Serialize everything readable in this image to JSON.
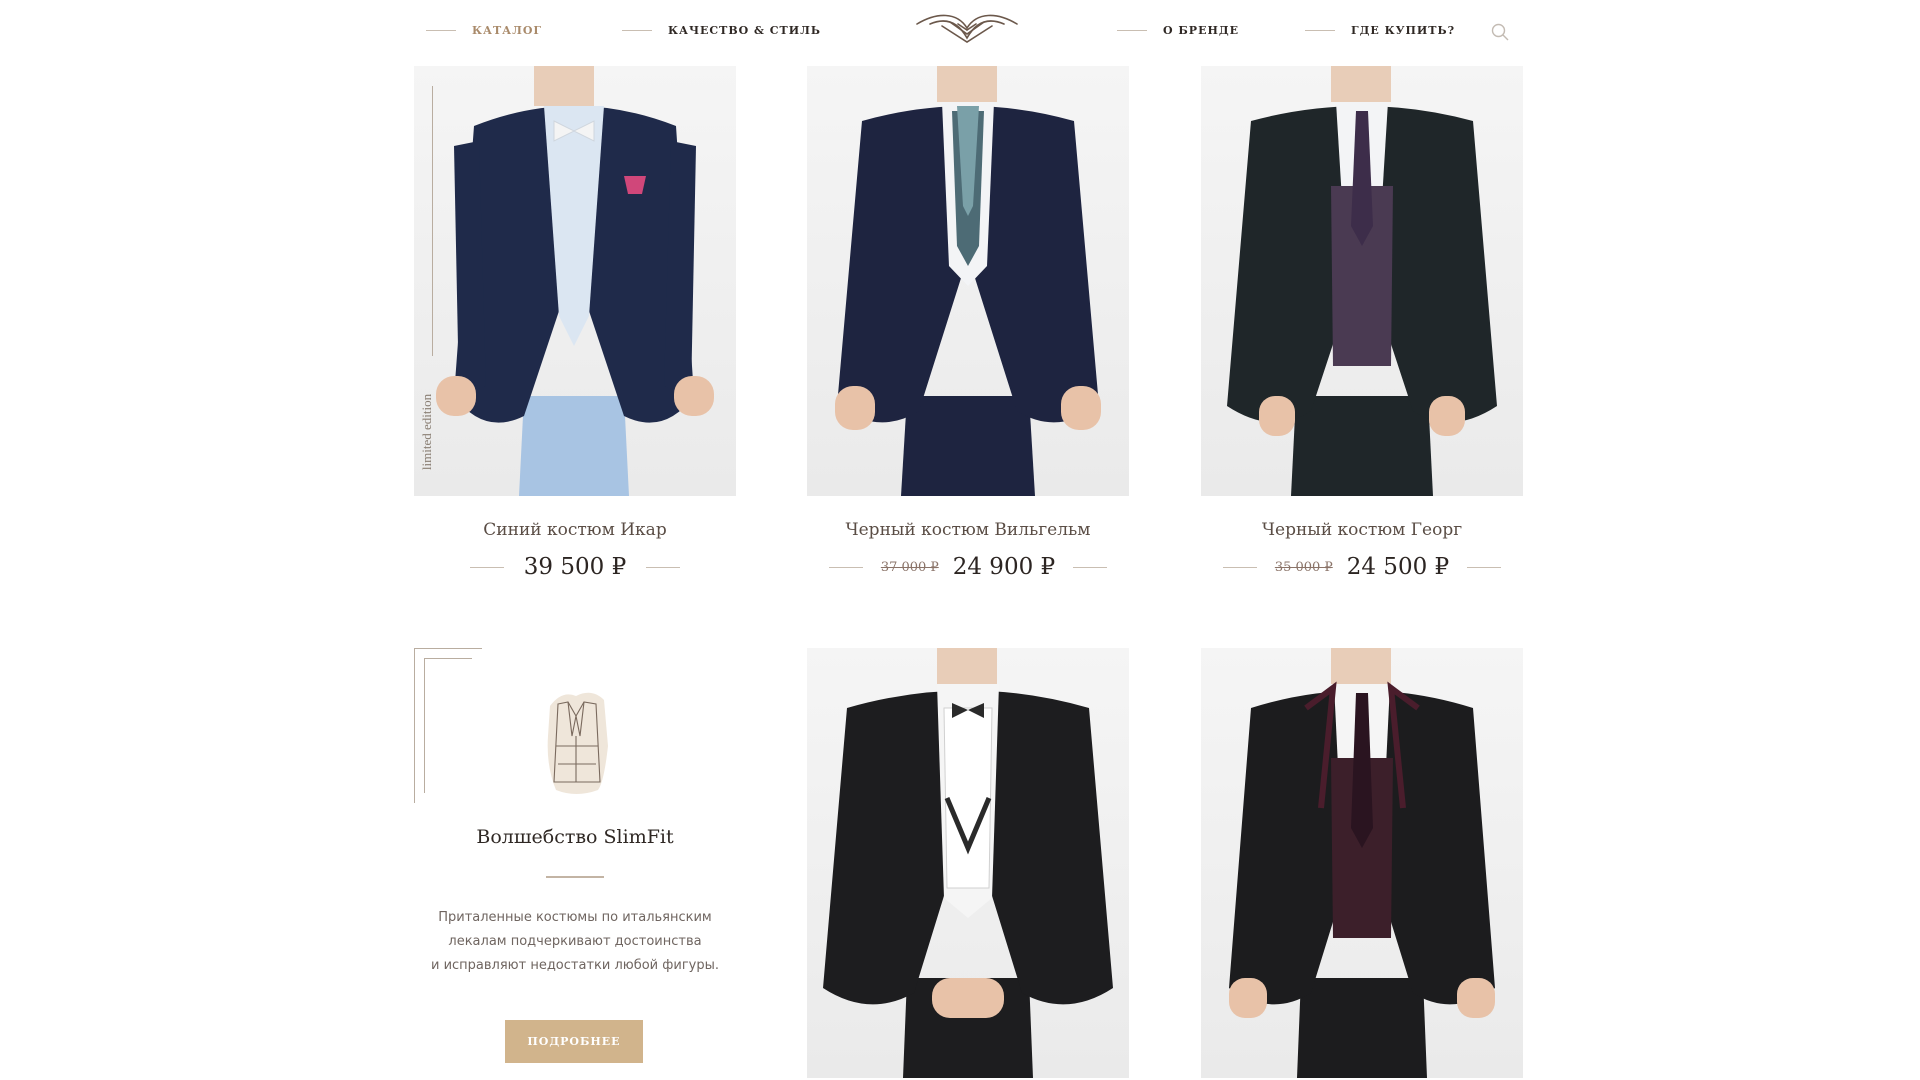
{
  "nav": {
    "items": [
      {
        "label": "КАТАЛОГ",
        "active": true
      },
      {
        "label": "КАЧЕСТВО & СТИЛЬ",
        "active": false
      },
      {
        "label": "О БРЕНДЕ",
        "active": false
      },
      {
        "label": "ГДЕ КУПИТЬ?",
        "active": false
      }
    ],
    "logo_icon": "ornament-logo-icon",
    "search_icon": "search-icon"
  },
  "products": [
    {
      "title": "Синий костюм Икар",
      "price": "39 500 ₽",
      "old_price": "",
      "badge": "limited edition",
      "jacket_color": "#1f2a4a",
      "shirt_color": "#dbe6f2",
      "pants_color": "#a8c4e3"
    },
    {
      "title": "Черный костюм Вильгельм",
      "price": "24 900 ₽",
      "old_price": "37 000 ₽",
      "badge": "",
      "jacket_color": "#1e2440",
      "shirt_color": "#f3f4f6",
      "pants_color": "#1e2440"
    },
    {
      "title": "Черный костюм Георг",
      "price": "24 500 ₽",
      "old_price": "35 000 ₽",
      "badge": "",
      "jacket_color": "#1f2629",
      "shirt_color": "#f3f4f6",
      "pants_color": "#1f2629"
    },
    {
      "title": "",
      "price": "",
      "old_price": "",
      "badge": "",
      "jacket_color": "#1d1d1f",
      "shirt_color": "#f5f5f5",
      "pants_color": "#1d1d1f"
    },
    {
      "title": "",
      "price": "",
      "old_price": "",
      "badge": "",
      "jacket_color": "#1c1c1e",
      "shirt_color": "#f5f5f5",
      "pants_color": "#1c1c1e"
    }
  ],
  "promo": {
    "title": "Волшебство SlimFit",
    "text_lines": [
      "Приталенные костюмы по итальянским",
      "лекалам подчеркивают достоинства",
      "и исправляют недостатки любой фигуры."
    ],
    "button_label": "ПОДРОБНЕЕ",
    "icon": "jacket-sketch-icon",
    "accent_color": "#d1b48c"
  }
}
